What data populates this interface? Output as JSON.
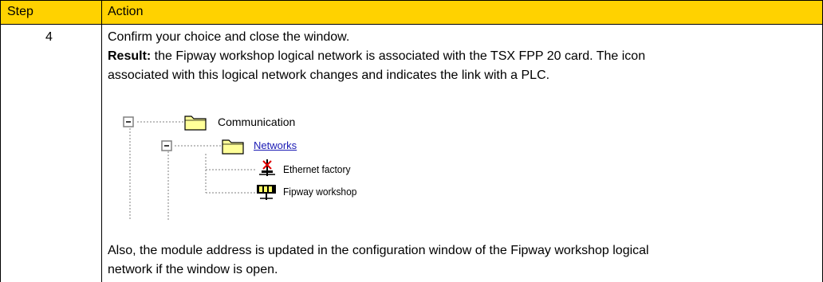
{
  "table": {
    "header": {
      "step": "Step",
      "action": "Action"
    },
    "row": {
      "step": "4",
      "line1": "Confirm your choice and close the window.",
      "result_label": "Result:",
      "result_text": " the Fipway workshop logical network is associated with the TSX FPP 20 card. The icon",
      "line3": "associated with this logical network changes and indicates the link with a PLC.",
      "tree": {
        "root": "Communication",
        "child": "Networks",
        "leaf1": "Ethernet factory",
        "leaf2": "Fipway workshop"
      },
      "also_line1": "Also, the module address is updated in the configuration window of the Fipway workshop logical",
      "also_line2": "network if the window is open."
    }
  },
  "colors": {
    "header_bg": "#ffd200",
    "border": "#000000",
    "link": "#1a1ab4"
  }
}
